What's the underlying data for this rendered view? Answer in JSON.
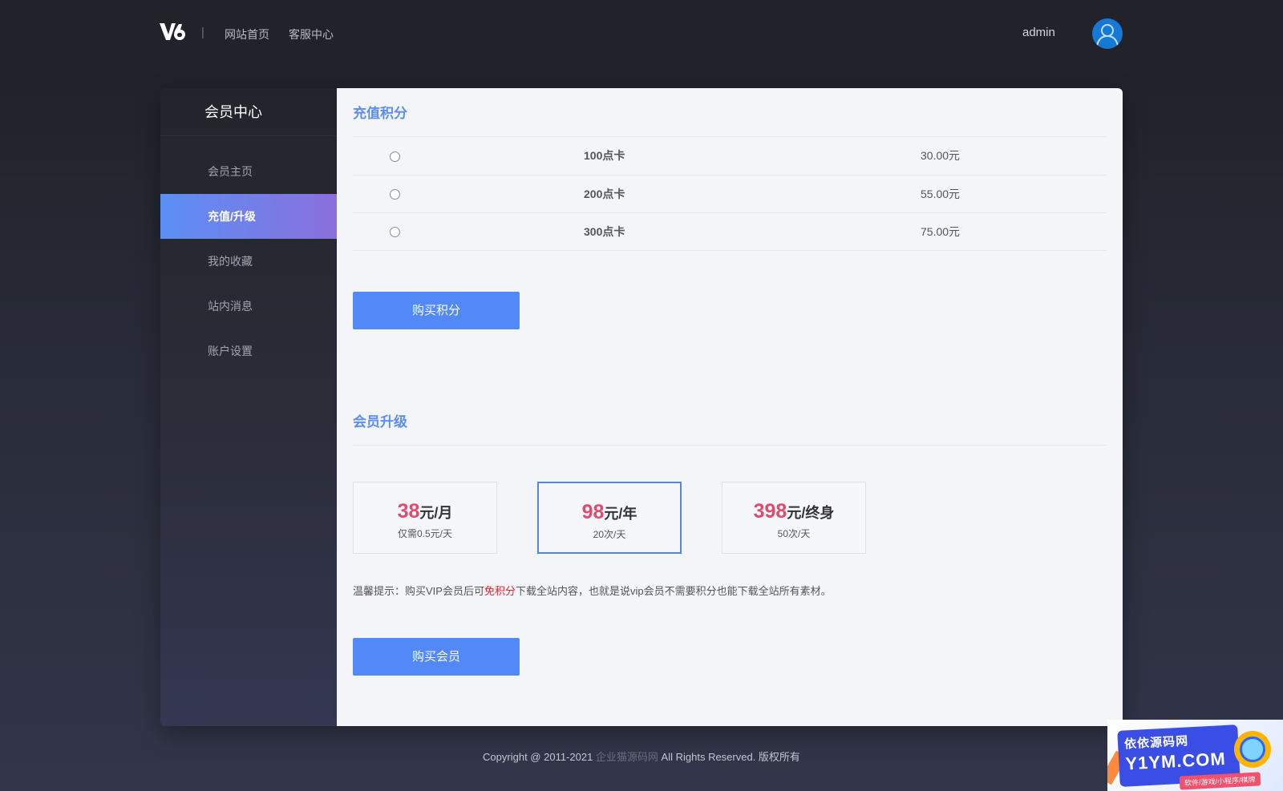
{
  "header": {
    "logo_icon": "v6-logo",
    "separator": "|",
    "nav": [
      {
        "label": "网站首页"
      },
      {
        "label": "客服中心"
      }
    ],
    "username": "admin",
    "avatar_icon": "user-avatar-icon"
  },
  "sidebar": {
    "title": "会员中心",
    "items": [
      {
        "label": "会员主页",
        "active": false
      },
      {
        "label": "充值/升级",
        "active": true
      },
      {
        "label": "我的收藏",
        "active": false
      },
      {
        "label": "站内消息",
        "active": false
      },
      {
        "label": "账户设置",
        "active": false
      }
    ]
  },
  "recharge": {
    "title": "充值积分",
    "options": [
      {
        "name": "100点卡",
        "price": "30.00元"
      },
      {
        "name": "200点卡",
        "price": "55.00元"
      },
      {
        "name": "300点卡",
        "price": "75.00元"
      }
    ],
    "button": "购买积分"
  },
  "vip": {
    "title": "会员升级",
    "plans": [
      {
        "price": "38",
        "unit": "元/月",
        "desc": "仅需0.5元/天",
        "selected": false
      },
      {
        "price": "98",
        "unit": "元/年",
        "desc": "20次/天",
        "selected": true
      },
      {
        "price": "398",
        "unit": "元/终身",
        "desc": "50次/天",
        "selected": false
      }
    ],
    "tip_prefix": "温馨提示：购买VIP会员后可",
    "tip_highlight": "免积分",
    "tip_suffix": "下载全站内容，也就是说vip会员不需要积分也能下载全站所有素材。",
    "button": "购买会员"
  },
  "footer": {
    "prefix": "Copyright @ 2011-2021 ",
    "site": "企业猫源码网",
    "suffix": " All Rights Reserved. 版权所有"
  },
  "watermark": {
    "line1": "依依源码网",
    "line2": "Y1YM.COM",
    "line3": "软件/游戏/小程序/棋牌"
  },
  "colors": {
    "accent": "#5389f7",
    "price": "#e5486d",
    "highlight": "#e8202a",
    "section_title": "#5c8ef2"
  }
}
